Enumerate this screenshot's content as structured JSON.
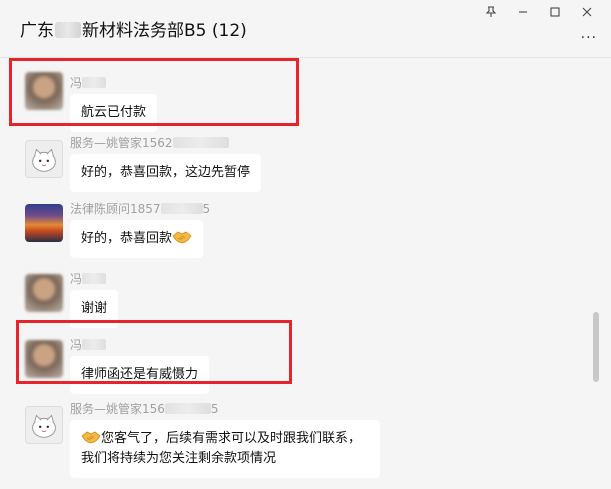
{
  "window": {
    "title_prefix": "广东",
    "title_suffix": "新材料法务部B5 (12)",
    "controls": {
      "pin": "⊤",
      "minimize": "—",
      "maximize": "☐",
      "close": "✕"
    },
    "more": "···"
  },
  "messages": [
    {
      "sender_prefix": "冯",
      "sender_suffix": "",
      "text": "航云已付款",
      "avatar": "person"
    },
    {
      "sender_prefix": "服务—姚管家1562",
      "sender_suffix": "",
      "text": "好的，恭喜回款，这边先暂停",
      "avatar": "cat"
    },
    {
      "sender_prefix": "法律陈顾问1857",
      "sender_suffix": "5",
      "text": "好的，恭喜回款",
      "avatar": "sunset"
    },
    {
      "sender_prefix": "冯",
      "sender_suffix": "",
      "text": "谢谢",
      "avatar": "person"
    },
    {
      "sender_prefix": "冯",
      "sender_suffix": "",
      "text": "律师函还是有威慑力",
      "avatar": "person"
    },
    {
      "sender_prefix": "服务—姚管家156",
      "sender_suffix": "5",
      "text": "您客气了，后续有需求可以及时跟我们联系，我们将持续为您关注剩余款项情况",
      "avatar": "cat"
    }
  ],
  "icons": {
    "handshake": "handshake-icon"
  },
  "colors": {
    "highlight_box": "#e8242b",
    "bubble": "#ffffff",
    "background": "#f5f5f5"
  }
}
